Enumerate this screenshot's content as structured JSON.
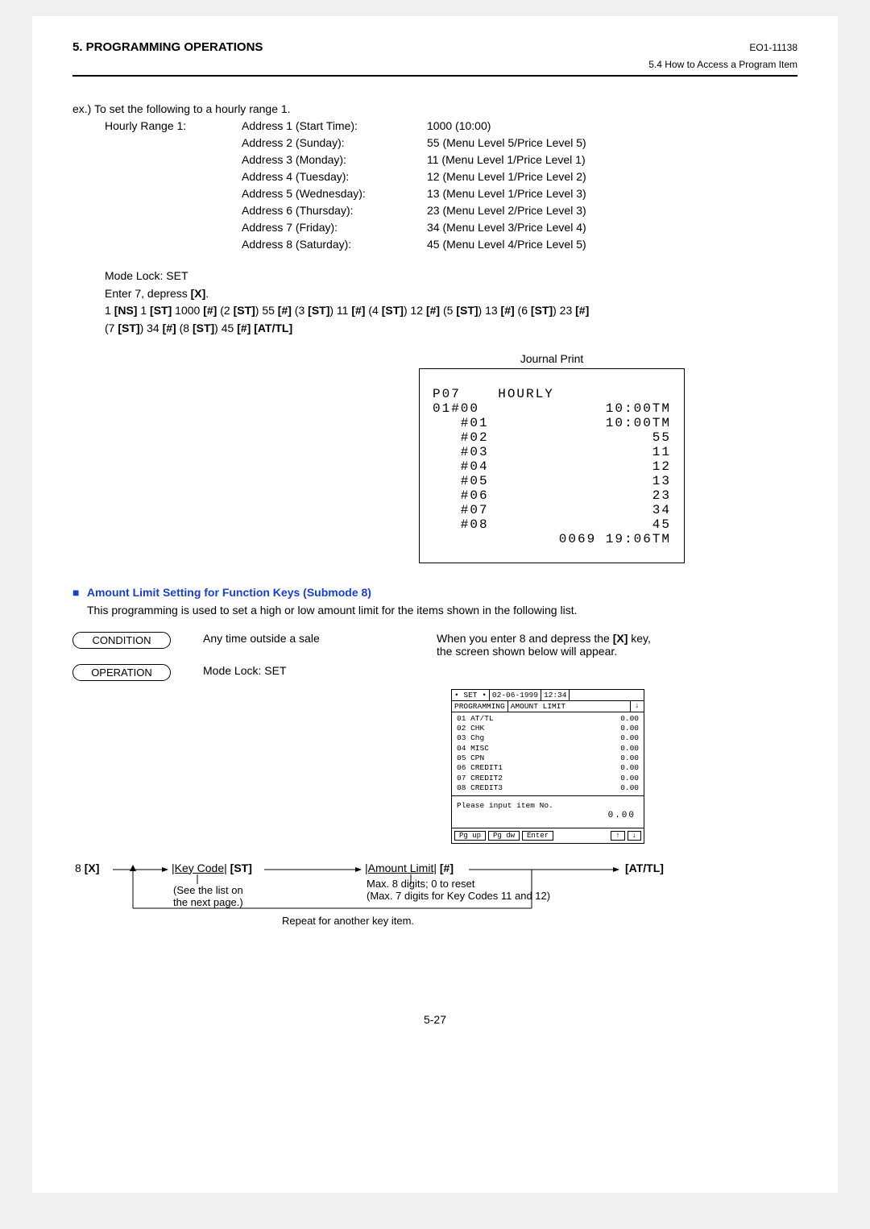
{
  "header": {
    "section": "5.   PROGRAMMING OPERATIONS",
    "docCode": "EO1-11138",
    "sub": "5.4  How to Access a Program Item"
  },
  "example": {
    "intro": "ex.)  To set the following to a hourly range 1.",
    "rangeLabel": "Hourly Range 1:",
    "rows": [
      {
        "addr": "Address 1 (Start Time):",
        "val": "1000 (10:00)"
      },
      {
        "addr": "Address 2 (Sunday):",
        "val": "55 (Menu Level 5/Price Level 5)"
      },
      {
        "addr": "Address 3 (Monday):",
        "val": "11 (Menu Level 1/Price Level 1)"
      },
      {
        "addr": "Address 4 (Tuesday):",
        "val": "12 (Menu Level 1/Price Level 2)"
      },
      {
        "addr": "Address 5 (Wednesday):",
        "val": "13 (Menu Level 1/Price Level 3)"
      },
      {
        "addr": "Address 6 (Thursday):",
        "val": "23 (Menu Level 2/Price Level 3)"
      },
      {
        "addr": "Address 7 (Friday):",
        "val": "34 (Menu Level 3/Price Level 4)"
      },
      {
        "addr": "Address 8 (Saturday):",
        "val": "45 (Menu Level 4/Price Level 5)"
      }
    ],
    "modeLock": "Mode Lock:  SET",
    "enterLine": "Enter 7, depress [X].",
    "seqLine1": "1 [NS]  1 [ST]  1000 [#]  (2 [ST]) 55 [#]  (3 [ST]) 11 [#]  (4 [ST]) 12 [#]  (5 [ST])  13 [#]  (6 [ST])  23 [#]",
    "seqLine2": "(7 [ST]) 34 [#]  (8 [ST]) 45 [#]  [AT/TL]"
  },
  "journal": {
    "label": "Journal Print",
    "title": "P07    HOURLY",
    "rows": [
      {
        "l": "01#00",
        "r": "10:00TM"
      },
      {
        "l": "   #01",
        "r": "10:00TM"
      },
      {
        "l": "   #02",
        "r": "55"
      },
      {
        "l": "   #03",
        "r": "11"
      },
      {
        "l": "   #04",
        "r": "12"
      },
      {
        "l": "   #05",
        "r": "13"
      },
      {
        "l": "   #06",
        "r": "23"
      },
      {
        "l": "   #07",
        "r": "34"
      },
      {
        "l": "   #08",
        "r": "45"
      }
    ],
    "foot": "0069 19:06TM"
  },
  "submode8": {
    "title": "Amount Limit Setting for Function Keys (Submode 8)",
    "desc": "This programming is used to set a high or low amount limit for the items shown in the following list.",
    "conditionLabel": "CONDITION",
    "conditionText": "Any time outside a sale",
    "operationLabel": "OPERATION",
    "operationText": "Mode Lock:  SET",
    "rightText1": "When you enter 8 and depress the [X] key,",
    "rightText2": "the screen shown below will appear."
  },
  "screen": {
    "set": "• SET •",
    "date": "02-06-1999",
    "time": "12:34",
    "tab1": "PROGRAMMING",
    "tab2": "AMOUNT LIMIT",
    "list": [
      {
        "l": "01 AT/TL",
        "r": "0.00"
      },
      {
        "l": "02 CHK",
        "r": "0.00"
      },
      {
        "l": "03 Chg",
        "r": "0.00"
      },
      {
        "l": "04 MISC",
        "r": "0.00"
      },
      {
        "l": "05 CPN",
        "r": "0.00"
      },
      {
        "l": "06 CREDIT1",
        "r": "0.00"
      },
      {
        "l": "07 CREDIT2",
        "r": "0.00"
      },
      {
        "l": "08 CREDIT3",
        "r": "0.00"
      }
    ],
    "msg": "Please input item No.",
    "amt": "0.00",
    "btnPgUp": "Pg up",
    "btnPgDw": "Pg dw",
    "btnEnter": "Enter",
    "btnUp": "↑",
    "btnDn": "↓",
    "scrollDn": "↓"
  },
  "flow": {
    "n1a": "8 ",
    "n1b": "[X]",
    "n2a": "|Key Code|",
    "n2b": "  [ST]",
    "n3a": "|Amount Limit|",
    "n3b": "  [#]",
    "n4": "[AT/TL]",
    "sub2a": "(See the list on",
    "sub2b": "the next page.)",
    "sub3a": "Max. 8 digits;  0 to reset",
    "sub3b": "(Max. 7 digits for Key Codes 11 and 12)",
    "repeat": "Repeat for another key item."
  },
  "pageNum": "5-27"
}
